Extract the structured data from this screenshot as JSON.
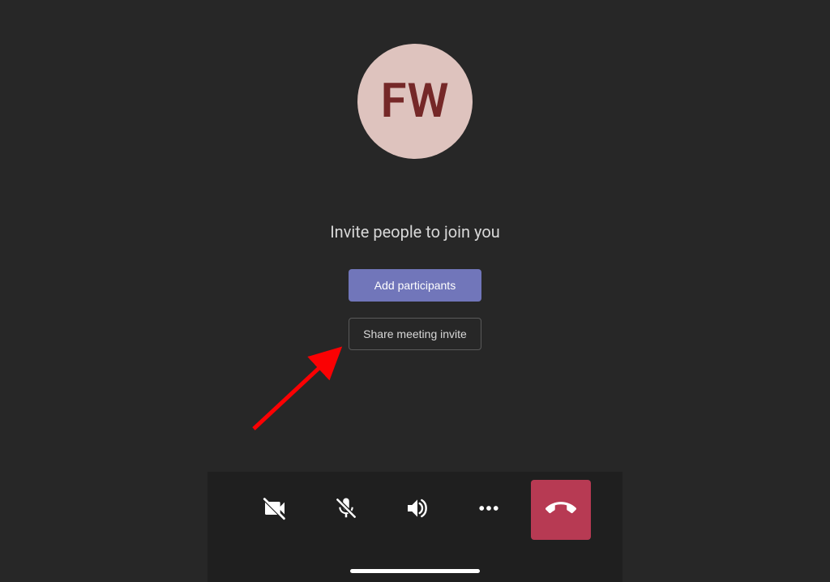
{
  "avatar": {
    "initials": "FW"
  },
  "prompt": {
    "invite_text": "Invite people to join you"
  },
  "buttons": {
    "add_participants_label": "Add participants",
    "share_invite_label": "Share meeting invite"
  },
  "toolbar": {
    "icons": {
      "camera": "camera-off-icon",
      "mic": "mic-off-icon",
      "speaker": "speaker-icon",
      "more": "more-icon",
      "hangup": "hangup-icon"
    }
  },
  "colors": {
    "background": "#272727",
    "avatar_bg": "#dec3be",
    "avatar_text": "#752828",
    "primary_btn": "#7176ba",
    "toolbar_bg": "#1f1f1f",
    "hangup_bg": "#b73a53",
    "arrow": "#fb0103"
  }
}
